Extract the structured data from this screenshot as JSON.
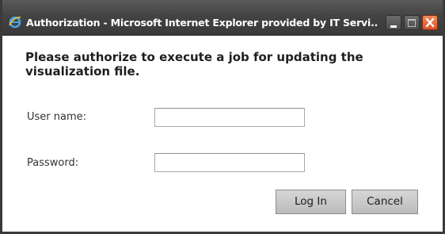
{
  "window": {
    "title": "Authorization - Microsoft Internet Explorer provided by IT Servi...",
    "app_icon": "internet-explorer-icon",
    "controls": {
      "minimize": "minimize-icon",
      "maximize": "maximize-icon",
      "close": "close-icon"
    }
  },
  "form": {
    "heading": "Please authorize to execute a job for updating the visualization file.",
    "username_label": "User name:",
    "username_value": "",
    "password_label": "Password:",
    "password_value": "",
    "login_label": "Log In",
    "cancel_label": "Cancel"
  },
  "colors": {
    "titlebar": "#434343",
    "close_button": "#d9542a",
    "button_face": "#c9c9c9"
  }
}
